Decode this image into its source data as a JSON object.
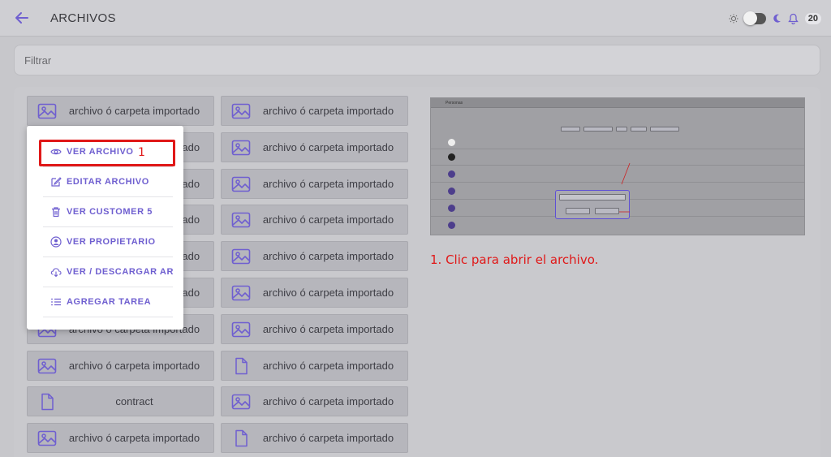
{
  "header": {
    "title": "ARCHIVOS",
    "notification_count": "20"
  },
  "filter": {
    "placeholder": "Filtrar"
  },
  "files": {
    "col_left": [
      {
        "label": "archivo ó carpeta importado",
        "icon": "image-icon"
      },
      {
        "label": "archivo ó carpeta importado",
        "icon": "image-icon"
      },
      {
        "label": "archivo ó carpeta importado",
        "icon": "image-icon"
      },
      {
        "label": "archivo ó carpeta importado",
        "icon": "image-icon"
      },
      {
        "label": "archivo ó carpeta importado",
        "icon": "image-icon"
      },
      {
        "label": "archivo ó carpeta importado",
        "icon": "image-icon"
      },
      {
        "label": "archivo ó carpeta importado",
        "icon": "image-icon"
      },
      {
        "label": "archivo ó carpeta importado",
        "icon": "image-icon"
      },
      {
        "label": "contract",
        "icon": "file-icon"
      },
      {
        "label": "archivo ó carpeta importado",
        "icon": "image-icon"
      }
    ],
    "col_right": [
      {
        "label": "archivo ó carpeta importado",
        "icon": "image-icon"
      },
      {
        "label": "archivo ó carpeta importado",
        "icon": "image-icon"
      },
      {
        "label": "archivo ó carpeta importado",
        "icon": "image-icon"
      },
      {
        "label": "archivo ó carpeta importado",
        "icon": "image-icon"
      },
      {
        "label": "archivo ó carpeta importado",
        "icon": "image-icon"
      },
      {
        "label": "archivo ó carpeta importado",
        "icon": "image-icon"
      },
      {
        "label": "archivo ó carpeta importado",
        "icon": "image-icon"
      },
      {
        "label": "archivo ó carpeta importado",
        "icon": "file-icon"
      },
      {
        "label": "archivo ó carpeta importado",
        "icon": "image-icon"
      },
      {
        "label": "archivo ó carpeta importado",
        "icon": "file-icon"
      }
    ]
  },
  "context_menu": {
    "items": [
      {
        "label": "VER ARCHIVO",
        "icon": "eye-icon"
      },
      {
        "label": "EDITAR ARCHIVO",
        "icon": "edit-icon"
      },
      {
        "label": "VER CUSTOMER 5",
        "icon": "trash-icon"
      },
      {
        "label": "VER PROPIETARIO",
        "icon": "user-circle-icon"
      },
      {
        "label": "VER / DESCARGAR AR",
        "icon": "cloud-download-icon"
      },
      {
        "label": "AGREGAR TAREA",
        "icon": "list-icon"
      }
    ]
  },
  "annotation": {
    "step_number": "1",
    "caption": "1. Clic para abrir el archivo.",
    "color": "#e01818"
  },
  "preview": {
    "title": "Personas"
  },
  "colors": {
    "accent": "#6f5fd0",
    "tile_bg": "#b6b6bc"
  }
}
